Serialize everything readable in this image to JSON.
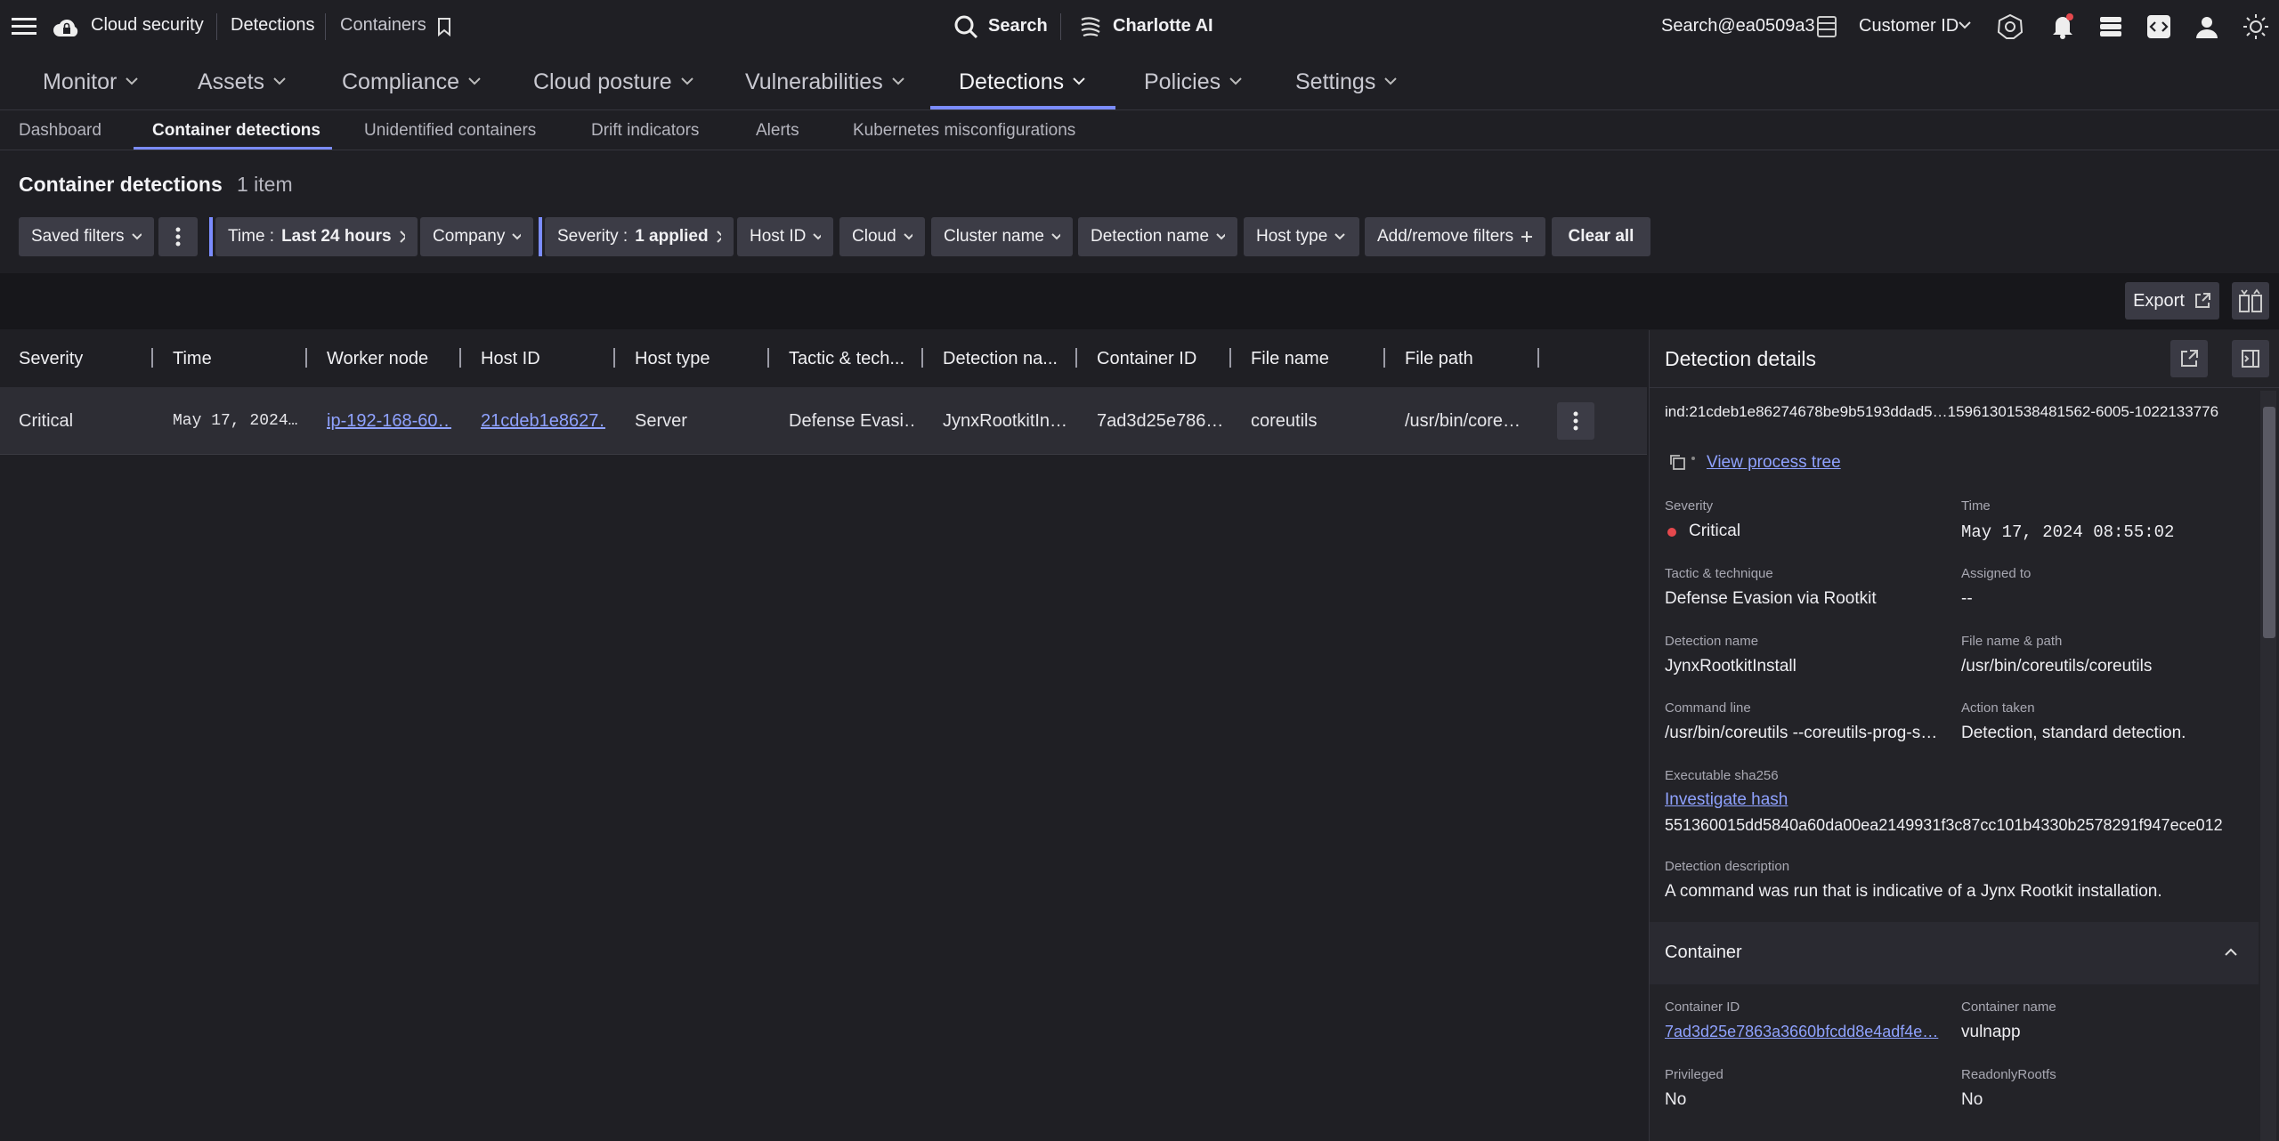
{
  "topbar": {
    "app_name": "Cloud security",
    "breadcrumb_1": "Detections",
    "breadcrumb_2": "Containers",
    "search_label": "Search",
    "ai_label": "Charlotte AI",
    "user": "Search@ea0509a3",
    "customer": "Customer ID"
  },
  "nav": {
    "items": [
      "Monitor",
      "Assets",
      "Compliance",
      "Cloud posture",
      "Vulnerabilities",
      "Detections",
      "Policies",
      "Settings"
    ]
  },
  "subnav": {
    "items": [
      "Dashboard",
      "Container detections",
      "Unidentified containers",
      "Drift indicators",
      "Alerts",
      "Kubernetes misconfigurations"
    ]
  },
  "page": {
    "title": "Container detections",
    "count": "1 item"
  },
  "filters": {
    "saved": "Saved filters",
    "time_label": "Time :",
    "time_value": "Last 24 hours",
    "company": "Company",
    "severity_label": "Severity :",
    "severity_value": "1 applied",
    "host_id": "Host ID",
    "cloud": "Cloud",
    "cluster": "Cluster name",
    "detection": "Detection name",
    "host_type": "Host type",
    "add_remove": "Add/remove filters",
    "clear": "Clear all"
  },
  "toolbar": {
    "export": "Export"
  },
  "table": {
    "columns": [
      "Severity",
      "Time",
      "Worker node",
      "Host ID",
      "Host type",
      "Tactic & tech...",
      "Detection na...",
      "Container ID",
      "File name",
      "File path"
    ],
    "row": {
      "severity": "Critical",
      "time": "May 17, 2024…",
      "worker_node": "ip-192-168-60…",
      "host_id": "21cdeb1e8627…",
      "host_type": "Server",
      "tactic": "Defense Evasi…",
      "detection": "JynxRootkitIn…",
      "container_id": "7ad3d25e786…",
      "file_name": "coreutils",
      "file_path": "/usr/bin/core…"
    }
  },
  "details": {
    "title": "Detection details",
    "id": "ind:21cdeb1e86274678be9b5193ddad5…15961301538481562-6005-1022133776",
    "process_tree": "View process tree",
    "severity_label": "Severity",
    "severity_value": "Critical",
    "time_label": "Time",
    "time_value": "May 17, 2024 08:55:02",
    "tactic_label": "Tactic & technique",
    "tactic_value": "Defense Evasion via Rootkit",
    "assigned_label": "Assigned to",
    "assigned_value": "--",
    "detname_label": "Detection name",
    "detname_value": "JynxRootkitInstall",
    "file_label": "File name & path",
    "file_value": "/usr/bin/coreutils/coreutils",
    "cmd_label": "Command line",
    "cmd_value": "/usr/bin/coreutils --coreutils-prog-s…",
    "action_label": "Action taken",
    "action_value": "Detection, standard detection.",
    "sha_label": "Executable sha256",
    "sha_link": "Investigate hash",
    "sha_value": "551360015dd5840a60da00ea2149931f3c87cc101b4330b2578291f947ece012",
    "desc_label": "Detection description",
    "desc_value": "A command was run that is indicative of a Jynx Rootkit installation.",
    "container_section": "Container",
    "cid_label": "Container ID",
    "cid_value": "7ad3d25e7863a3660bfcdd8e4adf4e…",
    "cname_label": "Container name",
    "cname_value": "vulnapp",
    "priv_label": "Privileged",
    "priv_value": "No",
    "rofs_label": "ReadonlyRootfs",
    "rofs_value": "No"
  },
  "colors": {
    "accent": "#7b8cff",
    "critical": "#e5484d",
    "link": "#8fa2ff"
  }
}
